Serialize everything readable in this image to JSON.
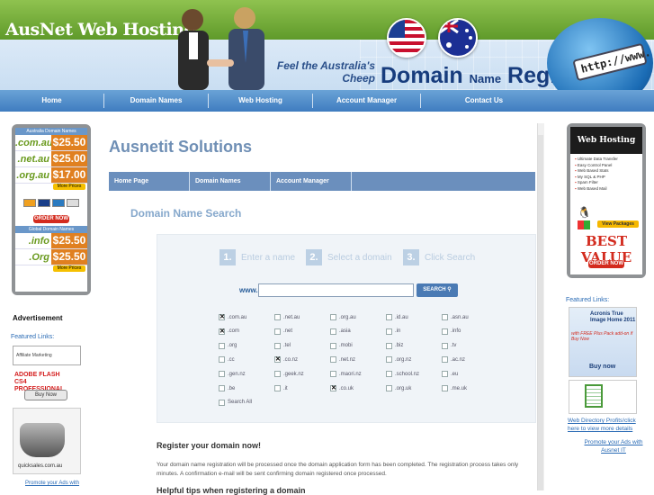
{
  "brand": "AusNet Web Hosting",
  "tagline": "Feel the Australia's Cheep",
  "registry_title": {
    "big": "Domain",
    "small": "Name",
    "end": "Registry"
  },
  "globe_text": "http://www.",
  "nav": [
    "Home",
    "Domain Names",
    "Web Hosting",
    "Account Manager",
    "Contact Us"
  ],
  "left_ad": {
    "header1": "Australia Domain Names",
    "rows1": [
      {
        "domain": ".com.au",
        "years": "2 YEARS",
        "price": "$25.50"
      },
      {
        "domain": ".net.au",
        "years": "2 YEARS",
        "price": "$25.00"
      },
      {
        "domain": ".org.au",
        "years": "2 YEARS",
        "price": "$17.00"
      }
    ],
    "more_prices": "More Prices",
    "order_now": "ORDER NOW",
    "header2": "Global Domain Names",
    "rows2": [
      {
        "domain": ".info",
        "years": "1 YEAR",
        "price": "$25.50"
      },
      {
        "domain": ".Org",
        "years": "1 YEAR",
        "price": "$25.50"
      }
    ],
    "more_prices2": "More Prices"
  },
  "advertisement": "Advertisement",
  "featured_links": "Featured Links:",
  "affiliate": "Affiliate Marketing",
  "flash": "ADOBE FLASH CS4 PROFESSIONAL",
  "buy_now": "Buy Now",
  "bag_label": "quicksales.com.au",
  "promote_left": "Promote your Ads with",
  "main_title": "Ausnetit Solutions",
  "subnav": [
    "Home Page",
    "Domain Names",
    "Account Manager",
    ""
  ],
  "dns_title": "Domain Name Search",
  "steps": [
    {
      "n": "1.",
      "t": "Enter a name"
    },
    {
      "n": "2.",
      "t": "Select a domain"
    },
    {
      "n": "3.",
      "t": "Click Search"
    }
  ],
  "www_label": "www.",
  "domain_input": {
    "value": "",
    "placeholder": ""
  },
  "search_label": "SEARCH",
  "tlds": [
    [
      {
        "t": ".com.au",
        "c": true
      },
      {
        "t": ".net.au",
        "c": false
      },
      {
        "t": ".org.au",
        "c": false
      },
      {
        "t": ".id.au",
        "c": false
      },
      {
        "t": ".asn.au",
        "c": false
      }
    ],
    [
      {
        "t": ".com",
        "c": true
      },
      {
        "t": ".net",
        "c": false
      },
      {
        "t": ".asia",
        "c": false
      },
      {
        "t": ".in",
        "c": false
      },
      {
        "t": ".info",
        "c": false
      }
    ],
    [
      {
        "t": ".org",
        "c": false
      },
      {
        "t": ".tel",
        "c": false
      },
      {
        "t": ".mobi",
        "c": false
      },
      {
        "t": ".biz",
        "c": false
      },
      {
        "t": ".tv",
        "c": false
      }
    ],
    [
      {
        "t": ".cc",
        "c": false
      },
      {
        "t": ".co.nz",
        "c": true
      },
      {
        "t": ".net.nz",
        "c": false
      },
      {
        "t": ".org.nz",
        "c": false
      },
      {
        "t": ".ac.nz",
        "c": false
      }
    ],
    [
      {
        "t": ".gen.nz",
        "c": false
      },
      {
        "t": ".geek.nz",
        "c": false
      },
      {
        "t": ".maori.nz",
        "c": false
      },
      {
        "t": ".school.nz",
        "c": false
      },
      {
        "t": ".eu",
        "c": false
      }
    ],
    [
      {
        "t": ".be",
        "c": false
      },
      {
        "t": ".it",
        "c": false
      },
      {
        "t": ".co.uk",
        "c": true
      },
      {
        "t": ".org.uk",
        "c": false
      },
      {
        "t": ".me.uk",
        "c": false
      }
    ],
    [
      {
        "t": "Search All",
        "c": false
      }
    ]
  ],
  "register_title": "Register your domain now!",
  "register_text": "Your domain name registration will be processed once the domain application form has been completed. The registration process takes only minutes. A confirmation e-mail will be sent confirming domain registered once processed.",
  "tips_title": "Helpful tips when registering a domain",
  "right_ad": {
    "title": "Web Hosting",
    "items": [
      "Ultimate Data Transfer",
      "Easy Control Panel",
      "Web Based Stats",
      "My SQL & PHP",
      "Spam Filter",
      "Web Based Mail"
    ],
    "view_packages": "View Packages",
    "best_value": "BEST VALUE",
    "order_now": "ORDER NOW"
  },
  "featured_right": "Featured Links:",
  "acronis": {
    "title": "Acronis True Image Home 2011",
    "free": "with FREE Plus Pack add-on if Buy Now",
    "buy": "Buy now"
  },
  "directory_text": "Web Directory Profits!click here to view more details",
  "promote_right": "Promote your Ads with Ausnet IT"
}
